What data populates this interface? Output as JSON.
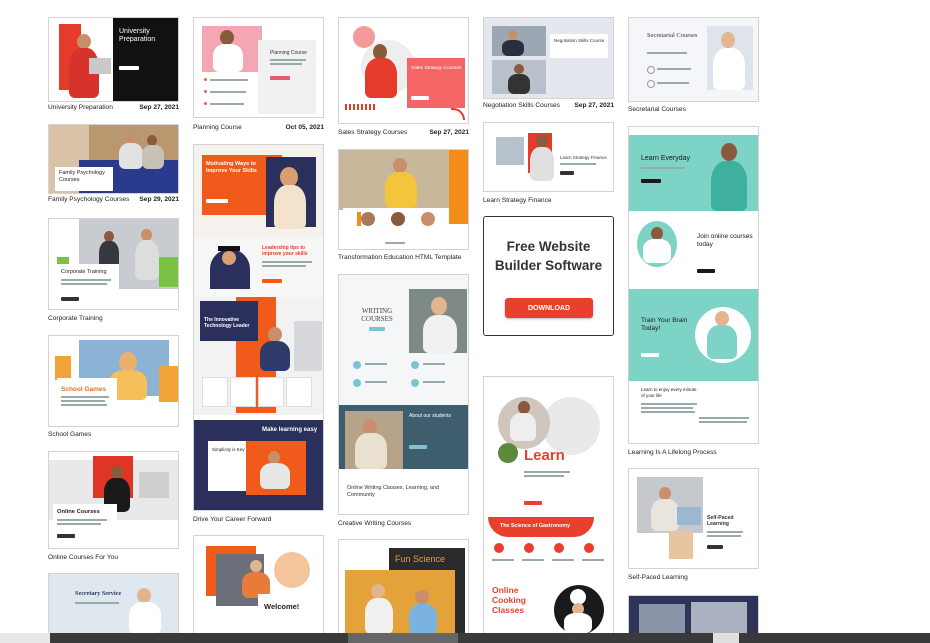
{
  "colors": {
    "accent": "#e8402d",
    "teal": "#7dd3c5",
    "navy": "#2a2f5b",
    "orange": "#f05a1a",
    "dark": "#222222"
  },
  "templates": {
    "university_preparation": {
      "caption": "University Preparation",
      "date": "Sep 27, 2021",
      "heading": "University Preparation"
    },
    "family_psychology": {
      "caption": "Family Psychology Courses",
      "date": "Sep 29, 2021",
      "heading": "Family Psychology Courses"
    },
    "corporate_training": {
      "caption": "Corporate Training",
      "heading": "Corporate Training"
    },
    "school_games": {
      "caption": "School Games",
      "heading": "School Games"
    },
    "online_courses": {
      "caption": "Online Courses For You",
      "heading": "Online Courses"
    },
    "secretary_service": {
      "heading": "Secretary Service"
    },
    "planning_course": {
      "caption": "Planning Course",
      "date": "Oct 05, 2021",
      "heading": "Planning Course"
    },
    "drive_career": {
      "caption": "Drive Your Career Forward",
      "heading1": "Motivating Ways to Improve Your Skills",
      "heading2": "Leadership tips to improve your skills",
      "heading3": "The Innovative Technology Leader",
      "heading4": "Make learning easy",
      "heading5": "Simplicity is Key"
    },
    "welcome": {
      "heading": "Welcome!"
    },
    "sales_strategy": {
      "caption": "Sales Strategy Courses",
      "date": "Sep 27, 2021",
      "heading": "Sales Strategy Courses"
    },
    "transformation_education": {
      "caption": "Transformation Education HTML Template"
    },
    "creative_writing": {
      "caption": "Creative Writing Courses",
      "heading": "WRITING COURSES",
      "heading2": "About our students",
      "heading3": "Online Writing Classes, Learning, and Community"
    },
    "fun_science": {
      "heading": "Fun Science"
    },
    "negotiation_skills": {
      "caption": "Negotiation Skills Courses",
      "date": "Sep 27, 2021",
      "heading": "Negotiation Skills Course"
    },
    "learn_strategy": {
      "caption": "Learn Strategy Finance",
      "heading": "Learn Strategy Finance"
    },
    "ad": {
      "title": "Free Website\nBuilder Software",
      "button": "DOWNLOAD"
    },
    "cooking": {
      "heading": "Learn",
      "heading2": "The Science of Gastronomy",
      "heading3": "Online Cooking Classes"
    },
    "secretarial": {
      "caption": "Secretarial Courses",
      "heading": "Secretarial Courses"
    },
    "lifelong": {
      "caption": "Learning Is A Lifelong Process",
      "heading1": "Learn Everyday",
      "heading2": "Join online courses today",
      "heading3": "Train Your Brain Today!",
      "heading4": "Learn to enjoy every minute of your life"
    },
    "self_paced": {
      "caption": "Self-Paced Learning",
      "heading": "Self-Paced Learning"
    }
  }
}
